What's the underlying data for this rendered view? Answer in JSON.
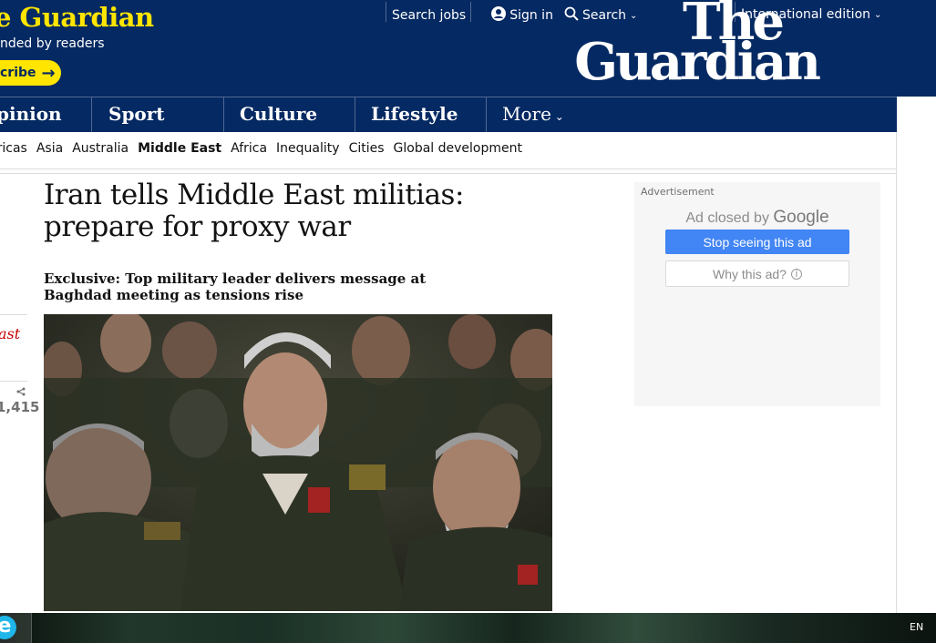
{
  "header": {
    "brand_partial": "e Guardian",
    "tagline_partial": "nded by readers",
    "subscribe_partial": "cribe",
    "links": {
      "search_jobs": "Search jobs",
      "sign_in": "Sign in",
      "search": "Search"
    },
    "edition": "International edition",
    "logo_line1": "The",
    "logo_line2": "Guardian"
  },
  "pillars": {
    "opinion_partial": "pinion",
    "sport": "Sport",
    "culture": "Culture",
    "lifestyle": "Lifestyle",
    "more": "More"
  },
  "subnav": {
    "items": [
      "ericas",
      "Asia",
      "Australia",
      "Middle East",
      "Africa",
      "Inequality",
      "Cities",
      "Global development"
    ],
    "active": "Middle East"
  },
  "sidebar": {
    "section_partial": "ast",
    "share_count_partial": "1,415"
  },
  "article": {
    "headline": "Iran tells Middle East militias: prepare for proxy war",
    "standfirst": "Exclusive: Top military leader delivers message at Baghdad meeting as tensions rise"
  },
  "ad": {
    "label": "Advertisement",
    "closed_by": "Ad closed by",
    "google": "Google",
    "stop_button": "Stop seeing this ad",
    "why_button": "Why this ad?"
  },
  "taskbar": {
    "language": "EN"
  },
  "colors": {
    "brand_blue": "#052962",
    "brand_yellow": "#ffe500",
    "section_red": "#c70000",
    "ad_blue": "#4285f4"
  }
}
